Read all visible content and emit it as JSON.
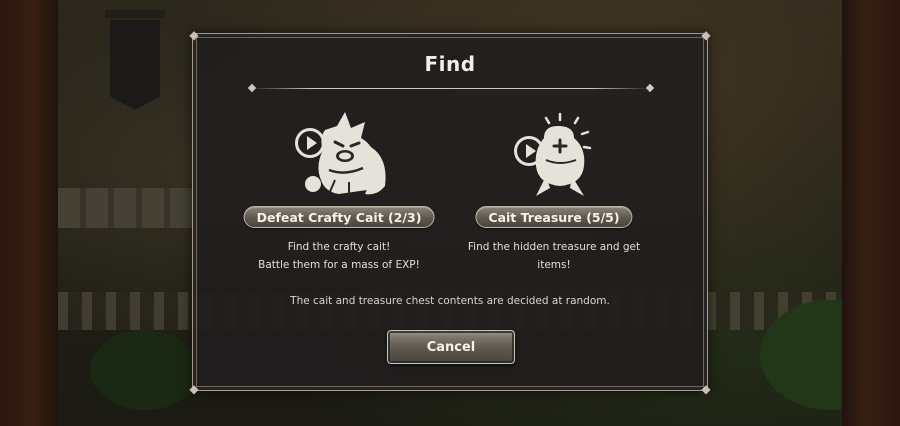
{
  "dialog": {
    "title": "Find",
    "options": [
      {
        "button_label": "Defeat Crafty Cait (2/3)",
        "description_line1": "Find the crafty cait!",
        "description_line2": "Battle them for a mass of EXP!",
        "icon": "cait-cat-play-icon"
      },
      {
        "button_label": "Cait Treasure (5/5)",
        "description_line1": "Find the hidden treasure and get items!",
        "description_line2": "",
        "icon": "cait-treasure-bag-play-icon"
      }
    ],
    "footnote": "The cait and treasure chest contents are decided at random.",
    "cancel_label": "Cancel"
  },
  "colors": {
    "panel": "#201e1e",
    "border": "#a49c90",
    "text": "#f2efe9",
    "button": "#5d574e"
  }
}
